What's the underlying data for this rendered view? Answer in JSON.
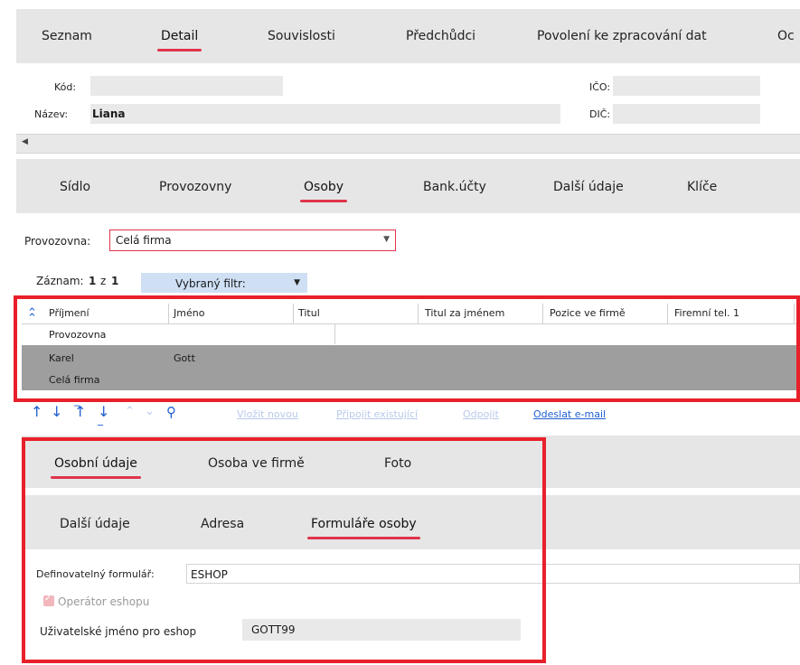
{
  "top_tabs": [
    "Seznam",
    "Detail",
    "Souvislosti",
    "Předchůdci",
    "Povolení ke zpracování dat",
    "Oc"
  ],
  "header": {
    "kod_label": "Kód:",
    "nazev_label": "Název:",
    "nazev_value": "Liana",
    "ico_label": "IČO:",
    "dic_label": "DIČ:"
  },
  "sub_tabs": [
    "Sídlo",
    "Provozovny",
    "Osoby",
    "Bank.účty",
    "Další údaje",
    "Klíče"
  ],
  "provozovna": {
    "label": "Provozovna:",
    "value": "Celá firma"
  },
  "zaznam": {
    "label": "Záznam:",
    "current": "1",
    "sep": "z",
    "total": "1"
  },
  "filter": {
    "label": "Vybraný filtr:"
  },
  "grid": {
    "columns": [
      "Příjmení",
      "Jméno",
      "Titul",
      "Titul za jménem",
      "Pozice ve firmě",
      "Firemní tel. 1"
    ],
    "group_row": "Provozovna",
    "selected_row": {
      "prijmeni": "Karel",
      "jmeno": "Gott",
      "sub": "Celá firma"
    }
  },
  "actions": {
    "new": "Vložit novou",
    "attach": "Připojit existující",
    "detach": "Odpojit",
    "email": "Odeslat e-mail"
  },
  "person_tabs": [
    "Osobní údaje",
    "Osoba ve firmě",
    "Foto"
  ],
  "person_subtabs": [
    "Další údaje",
    "Adresa",
    "Formuláře osoby"
  ],
  "form": {
    "defin_label": "Definovatelný formulář:",
    "defin_value": "ESHOP",
    "operator_label": "Operátor eshopu",
    "username_label": "Uživatelské jméno pro eshop",
    "username_value": "GOTT99"
  },
  "colors": {
    "accent": "#e0344a",
    "redbox": "#e8202a",
    "link": "#1f5fd1",
    "selected_row": "#9e9e9e"
  }
}
